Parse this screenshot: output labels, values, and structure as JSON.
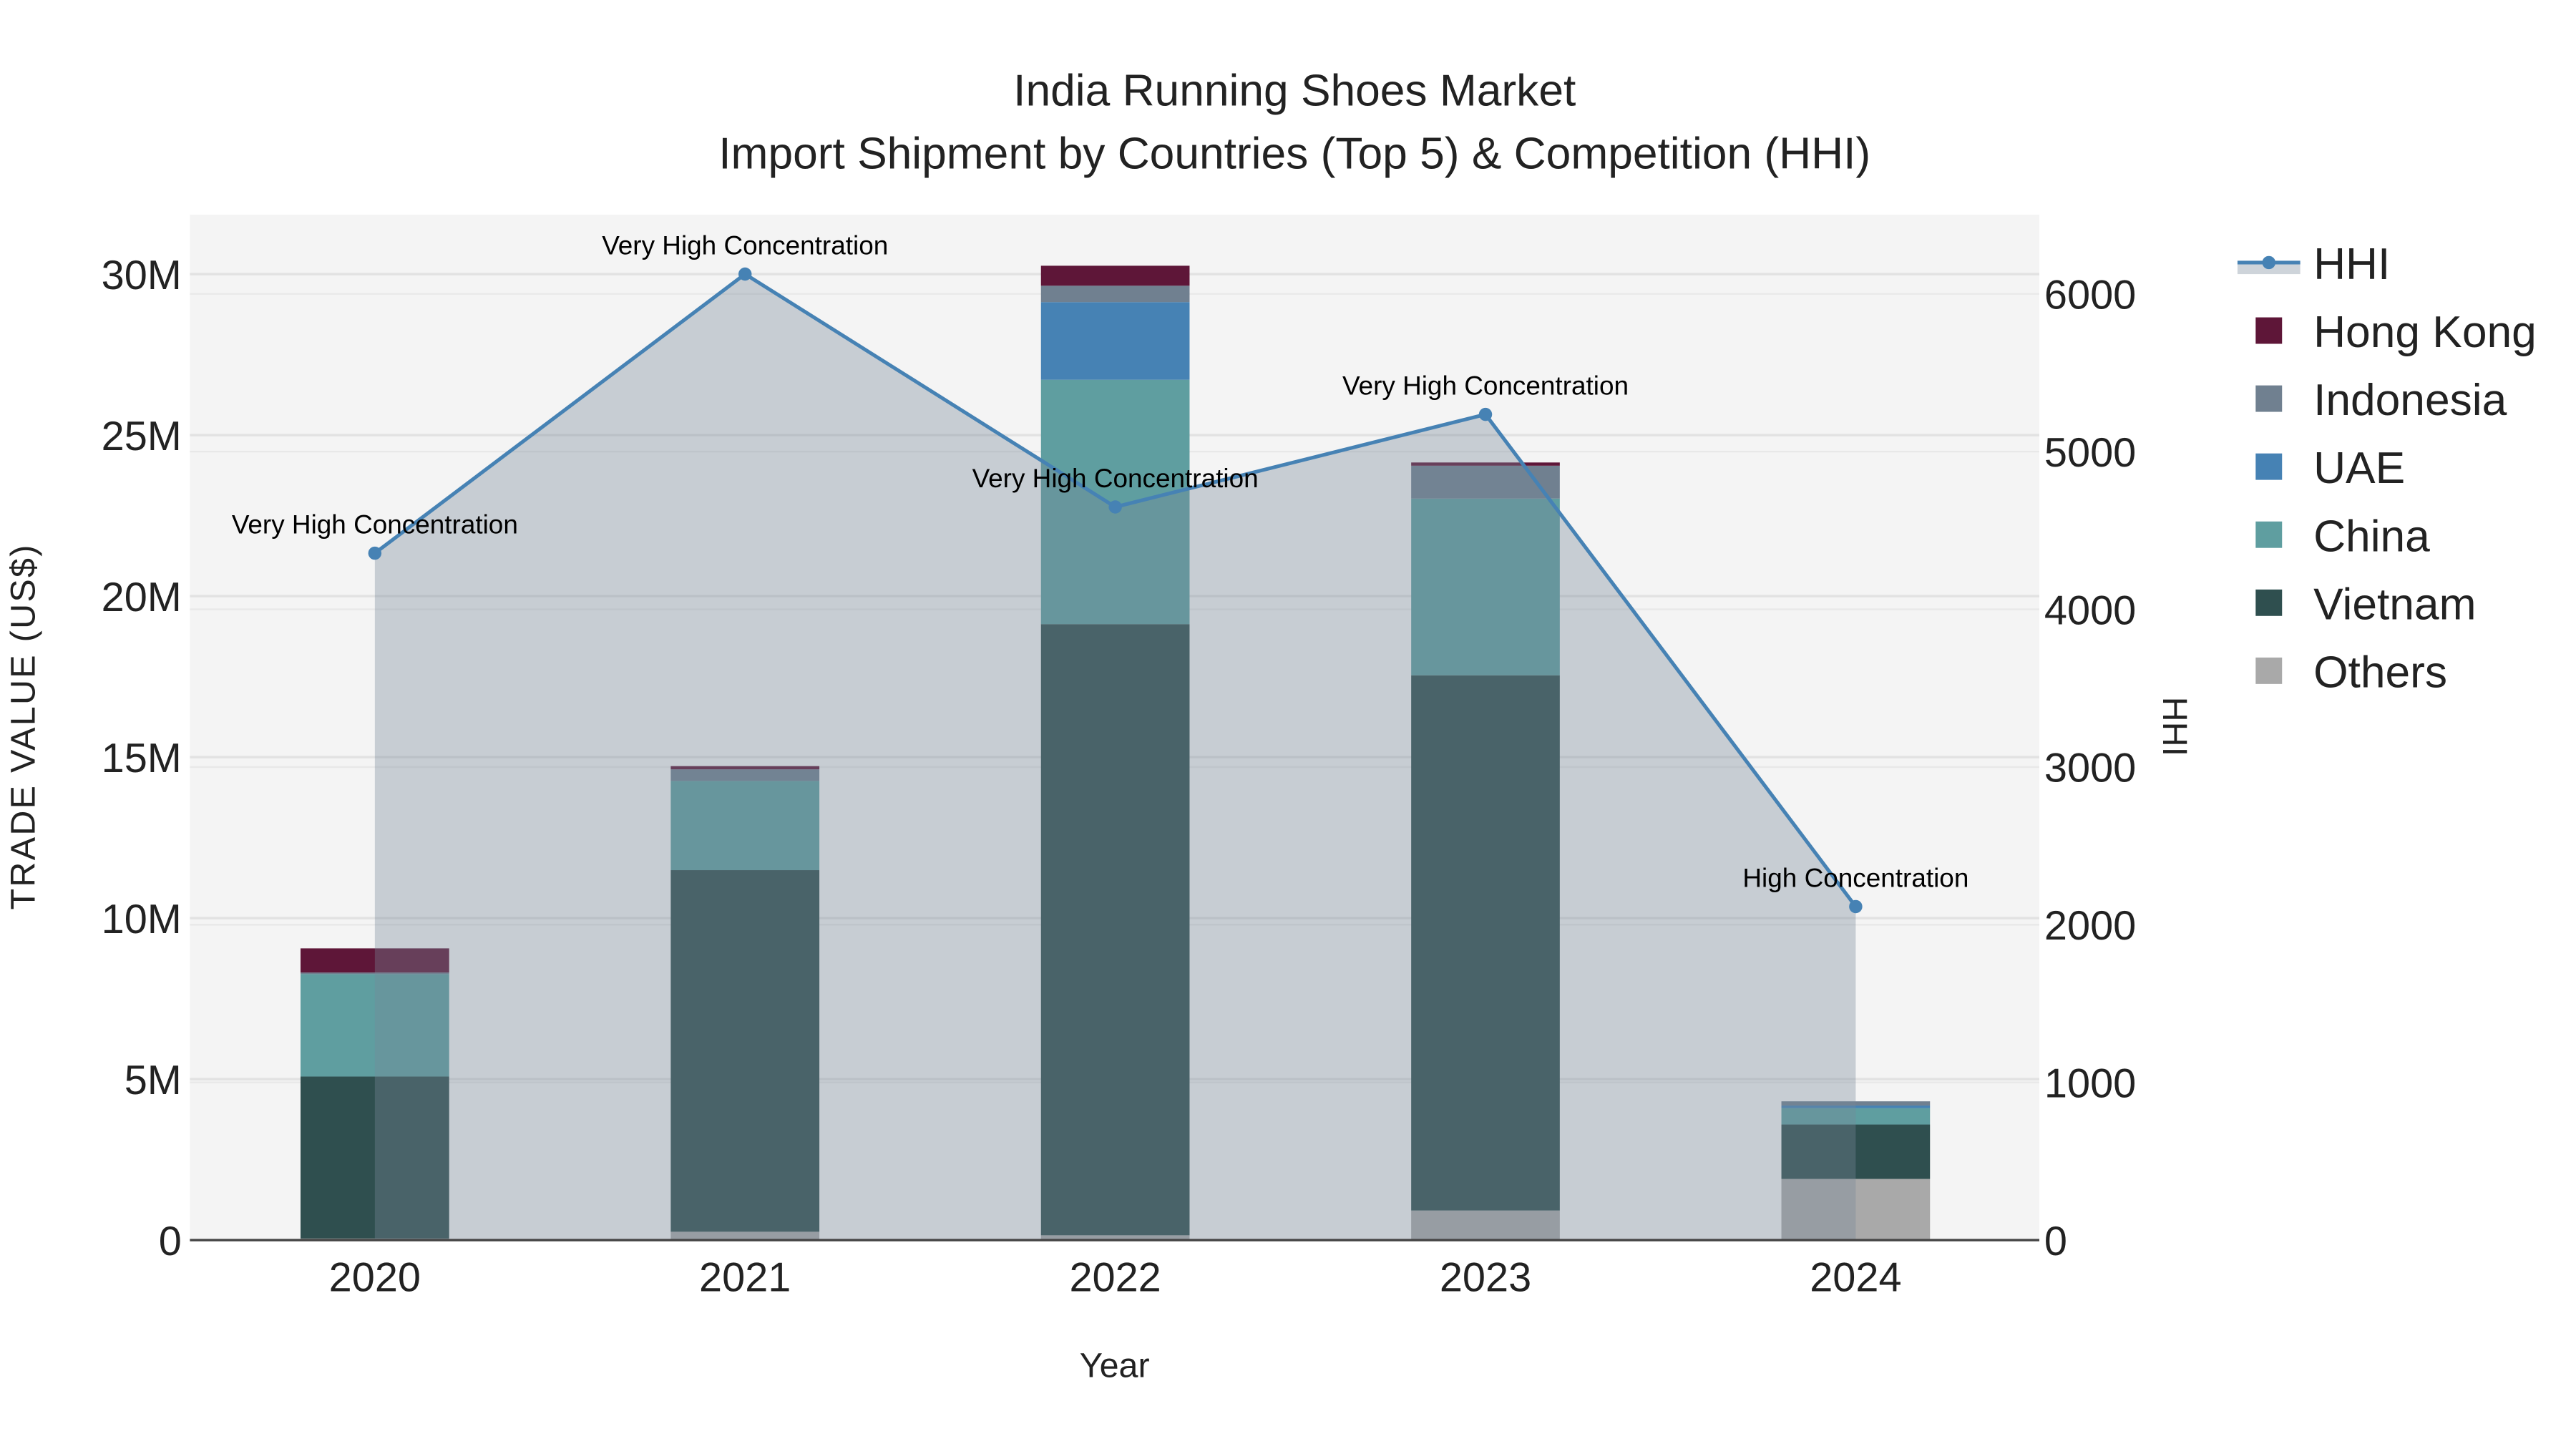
{
  "chart_data": {
    "type": "bar",
    "title_line1": "India Running Shoes Market",
    "title_line2": "Import Shipment by Countries (Top 5) & Competition (HHI)",
    "xlabel": "Year",
    "ylabel": "TRADE VALUE (US$)",
    "y2label": "HHI",
    "categories": [
      "2020",
      "2021",
      "2022",
      "2023",
      "2024"
    ],
    "ylim": [
      0,
      31.9
    ],
    "y_unit": "M",
    "y_ticks": [
      0,
      5,
      10,
      15,
      20,
      25,
      30
    ],
    "y_tick_labels": [
      "0",
      "5M",
      "10M",
      "15M",
      "20M",
      "25M",
      "30M"
    ],
    "y2lim": [
      0,
      6500
    ],
    "y2_ticks": [
      0,
      1000,
      2000,
      3000,
      4000,
      5000,
      6000
    ],
    "y2_tick_labels": [
      "0",
      "1000",
      "2000",
      "3000",
      "4000",
      "5000",
      "6000"
    ],
    "stacked": true,
    "series": [
      {
        "name": "Others",
        "color": "#A9A9A9",
        "values": [
          0.05,
          0.26,
          0.15,
          0.92,
          1.9
        ]
      },
      {
        "name": "Vietnam",
        "color": "#2F4F4F",
        "values": [
          5.03,
          11.23,
          18.98,
          16.62,
          1.69
        ]
      },
      {
        "name": "China",
        "color": "#5F9EA0",
        "values": [
          3.18,
          2.77,
          7.59,
          5.49,
          0.51
        ]
      },
      {
        "name": "UAE",
        "color": "#4682B4",
        "values": [
          0,
          0,
          2.41,
          0,
          0.08
        ]
      },
      {
        "name": "Indonesia",
        "color": "#708090",
        "values": [
          0.05,
          0.36,
          0.51,
          1.02,
          0.13
        ]
      },
      {
        "name": "Hong Kong",
        "color": "#5E1638",
        "values": [
          0.75,
          0.1,
          0.62,
          0.1,
          0
        ]
      }
    ],
    "line_series": {
      "name": "HHI",
      "color": "#4682B4",
      "axis": "y2",
      "values": [
        4356,
        6126,
        4649,
        5236,
        2115
      ],
      "annotations": [
        "Very High Concentration",
        "Very High Concentration",
        "Very High Concentration",
        "Very High Concentration",
        "High Concentration"
      ]
    },
    "legend": [
      "HHI",
      "Hong Kong",
      "Indonesia",
      "UAE",
      "China",
      "Vietnam",
      "Others"
    ],
    "legend_position": "right",
    "grid": true
  }
}
